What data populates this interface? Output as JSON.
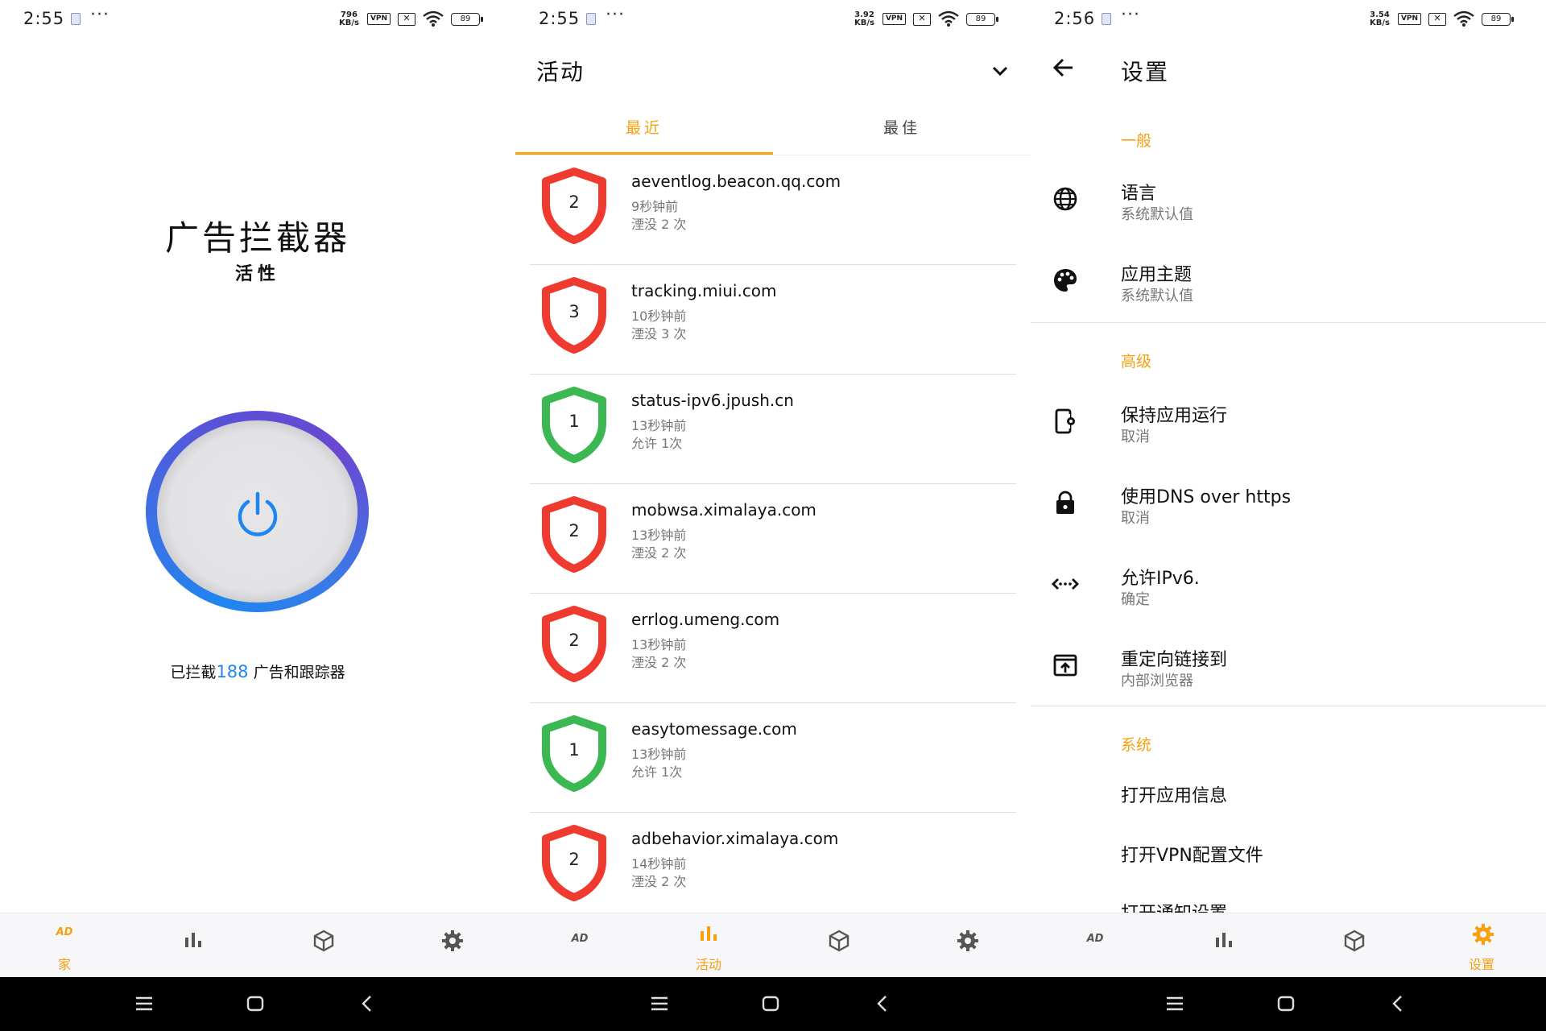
{
  "status": {
    "screen1": {
      "time": "2:55",
      "speed_top": "796",
      "speed_unit": "KB/s",
      "vpn": "VPN",
      "battery": "89"
    },
    "screen2": {
      "time": "2:55",
      "speed_top": "3.92",
      "speed_unit": "KB/s",
      "vpn": "VPN",
      "battery": "89"
    },
    "screen3": {
      "time": "2:56",
      "speed_top": "3.54",
      "speed_unit": "KB/s",
      "vpn": "VPN",
      "battery": "89"
    },
    "more": "···"
  },
  "home": {
    "title": "广告拦截器",
    "status": "活性",
    "blocked_prefix": "已拦截",
    "blocked_count": "188",
    "blocked_suffix": " 广告和跟踪器",
    "power_color": "#1f86f0"
  },
  "activity": {
    "title": "活动",
    "tabs": [
      "最近",
      "最佳"
    ],
    "items": [
      {
        "domain": "aeventlog.beacon.qq.com",
        "time": "9秒钟前",
        "count": "湮没 2 次",
        "badge": "2",
        "status": "blocked"
      },
      {
        "domain": "tracking.miui.com",
        "time": "10秒钟前",
        "count": "湮没 3 次",
        "badge": "3",
        "status": "blocked"
      },
      {
        "domain": "status-ipv6.jpush.cn",
        "time": "13秒钟前",
        "count": "允许 1次",
        "badge": "1",
        "status": "allowed"
      },
      {
        "domain": "mobwsa.ximalaya.com",
        "time": "13秒钟前",
        "count": "湮没 2 次",
        "badge": "2",
        "status": "blocked"
      },
      {
        "domain": "errlog.umeng.com",
        "time": "13秒钟前",
        "count": "湮没 2 次",
        "badge": "2",
        "status": "blocked"
      },
      {
        "domain": "easytomessage.com",
        "time": "13秒钟前",
        "count": "允许 1次",
        "badge": "1",
        "status": "allowed"
      },
      {
        "domain": "adbehavior.ximalaya.com",
        "time": "14秒钟前",
        "count": "湮没 2 次",
        "badge": "2",
        "status": "blocked"
      }
    ],
    "colors": {
      "blocked": "#ef3b2f",
      "allowed": "#3cb853",
      "accent": "#f5a00e"
    }
  },
  "settings": {
    "title": "设置",
    "sections": {
      "general": "一般",
      "advanced": "高级",
      "system": "系统"
    },
    "language": {
      "label": "语言",
      "value": "系统默认值"
    },
    "theme": {
      "label": "应用主题",
      "value": "系统默认值"
    },
    "keep_running": {
      "label": "保持应用运行",
      "value": "取消"
    },
    "dns_https": {
      "label": "使用DNS over https",
      "value": "取消"
    },
    "ipv6": {
      "label": "允许IPv6.",
      "value": "确定"
    },
    "redirect": {
      "label": "重定向链接到",
      "value": "内部浏览器"
    },
    "open_app_info": "打开应用信息",
    "open_vpn_profile": "打开VPN配置文件",
    "open_notifications": "打开通知设置"
  },
  "nav": {
    "ad_logo": "AD",
    "home_label": "家",
    "activity_label": "活动",
    "settings_label": "设置"
  }
}
